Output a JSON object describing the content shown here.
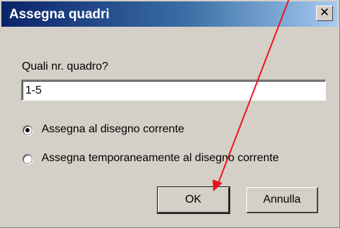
{
  "dialog": {
    "title": "Assegna quadri",
    "close_glyph": "✕",
    "prompt": "Quali nr. quadro?",
    "input_value": "1-5",
    "options": [
      {
        "label": "Assegna al disegno corrente",
        "selected": true
      },
      {
        "label": "Assegna temporaneamente al disegno corrente",
        "selected": false
      }
    ],
    "ok_label": "OK",
    "cancel_label": "Annulla"
  },
  "annotation": {
    "arrow_color": "#e8141c",
    "points_to": "ok-button"
  }
}
